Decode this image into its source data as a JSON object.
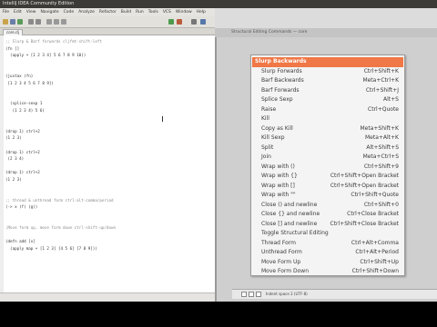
{
  "window": {
    "title": "IntelliJ IDEA Community Edition"
  },
  "menubar": [
    "File",
    "Edit",
    "View",
    "Navigate",
    "Code",
    "Analyze",
    "Refactor",
    "Build",
    "Run",
    "Tools",
    "VCS",
    "Window",
    "Help"
  ],
  "tab": {
    "label": "core.clj"
  },
  "editor": {
    "lines": [
      ";; Slurp & Barf forwards cljfmt-shift-left",
      "(fn []",
      "  (apply + [1 2 3 4] 5 6 7 8 9 10))",
      "",
      "",
      "(juxtax (fn)",
      " [1 2 3 4 5 6 7 8 9])",
      "",
      "",
      "  (splice-sexp 1",
      "   (1 2 3 4) 5 6)",
      "",
      "",
      "(drop 1) ctrl+2",
      "(1 2 3)",
      "",
      "(drop 1) ctrl+2",
      " (2 3 4)",
      "",
      "(drop 1) ctrl+2",
      "(1 2 3)",
      "",
      "",
      ";; thread & unthread form ctrl-alt-comma/period",
      "(-> x (f) (g))",
      "",
      "",
      ";Move form up, move form down ctrl-shift-up/down",
      "",
      "(defn add [x]",
      "  (apply map + [1 2 3] [4 5 6] [7 8 9]))"
    ]
  },
  "right_header": "Structural Editing Commands — core",
  "context_menu": {
    "items": [
      {
        "label": "Slurp Backwards",
        "shortcut": ""
      },
      {
        "label": "Slurp Forwards",
        "shortcut": "Ctrl+Shift+K"
      },
      {
        "label": "Barf Backwards",
        "shortcut": "Meta+Ctrl+K"
      },
      {
        "label": "Barf Forwards",
        "shortcut": "Ctrl+Shift+J"
      },
      {
        "label": "Splice Sexp",
        "shortcut": "Alt+S"
      },
      {
        "label": "Raise",
        "shortcut": "Ctrl+Quote"
      },
      {
        "label": "Kill",
        "shortcut": ""
      },
      {
        "label": "Copy as Kill",
        "shortcut": "Meta+Shift+K"
      },
      {
        "label": "Kill Sexp",
        "shortcut": "Meta+Alt+K"
      },
      {
        "label": "Split",
        "shortcut": "Alt+Shift+S"
      },
      {
        "label": "Join",
        "shortcut": "Meta+Ctrl+S"
      },
      {
        "label": "Wrap with ()",
        "shortcut": "Ctrl+Shift+9"
      },
      {
        "label": "Wrap with {}",
        "shortcut": "Ctrl+Shift+Open Bracket"
      },
      {
        "label": "Wrap with []",
        "shortcut": "Ctrl+Shift+Open Bracket"
      },
      {
        "label": "Wrap with \"\"",
        "shortcut": "Ctrl+Shift+Quote"
      },
      {
        "label": "Close () and newline",
        "shortcut": "Ctrl+Shift+0"
      },
      {
        "label": "Close {} and newline",
        "shortcut": "Ctrl+Close Bracket"
      },
      {
        "label": "Close [] and newline",
        "shortcut": "Ctrl+Shift+Close Bracket"
      },
      {
        "label": "Toggle Structural Editing",
        "shortcut": ""
      },
      {
        "label": "Thread Form",
        "shortcut": "Ctrl+Alt+Comma"
      },
      {
        "label": "Unthread Form",
        "shortcut": "Ctrl+Alt+Period"
      },
      {
        "label": "Move Form Up",
        "shortcut": "Ctrl+Shift+Up"
      },
      {
        "label": "Move Form Down",
        "shortcut": "Ctrl+Shift+Down"
      }
    ],
    "highlighted_index": 0
  },
  "bottom": {
    "status": "Indent space 2 (UTF-8)"
  },
  "colors": {
    "highlight": "#f07746",
    "titlebar": "#3c3b37"
  }
}
